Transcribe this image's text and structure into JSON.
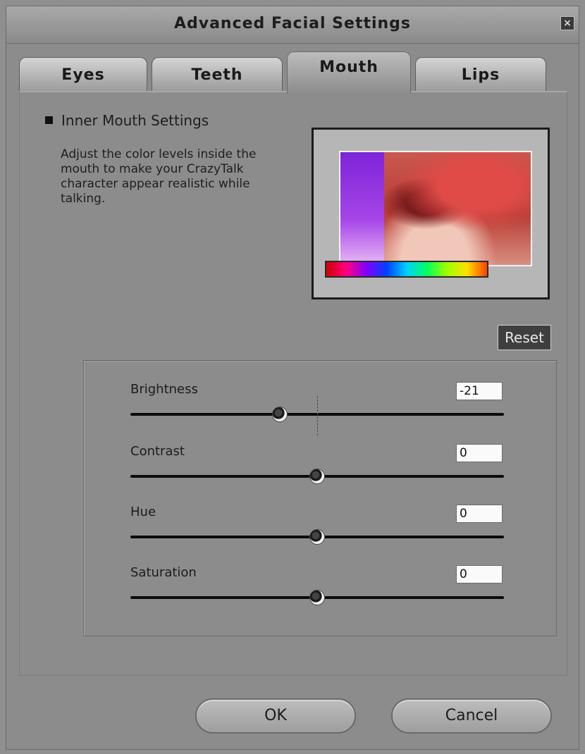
{
  "window": {
    "title": "Advanced Facial Settings",
    "close_glyph": "×"
  },
  "tabs": [
    {
      "label": "Eyes",
      "active": false
    },
    {
      "label": "Teeth",
      "active": false
    },
    {
      "label": "Mouth",
      "active": true
    },
    {
      "label": "Lips",
      "active": false
    }
  ],
  "section": {
    "heading": "Inner Mouth Settings",
    "description": "Adjust the color levels inside the mouth to make your CrazyTalk character appear realistic while talking."
  },
  "reset_label": "Reset",
  "sliders": [
    {
      "label": "Brightness",
      "value": "-21",
      "level": 0.4
    },
    {
      "label": "Contrast",
      "value": "0",
      "level": 0.5
    },
    {
      "label": "Hue",
      "value": "0",
      "level": 0.5
    },
    {
      "label": "Saturation",
      "value": "0",
      "level": 0.5
    }
  ],
  "buttons": {
    "ok": "OK",
    "cancel": "Cancel"
  },
  "colors": {
    "background": "#8c8c8c",
    "reset_bg": "#3f3f3f"
  }
}
